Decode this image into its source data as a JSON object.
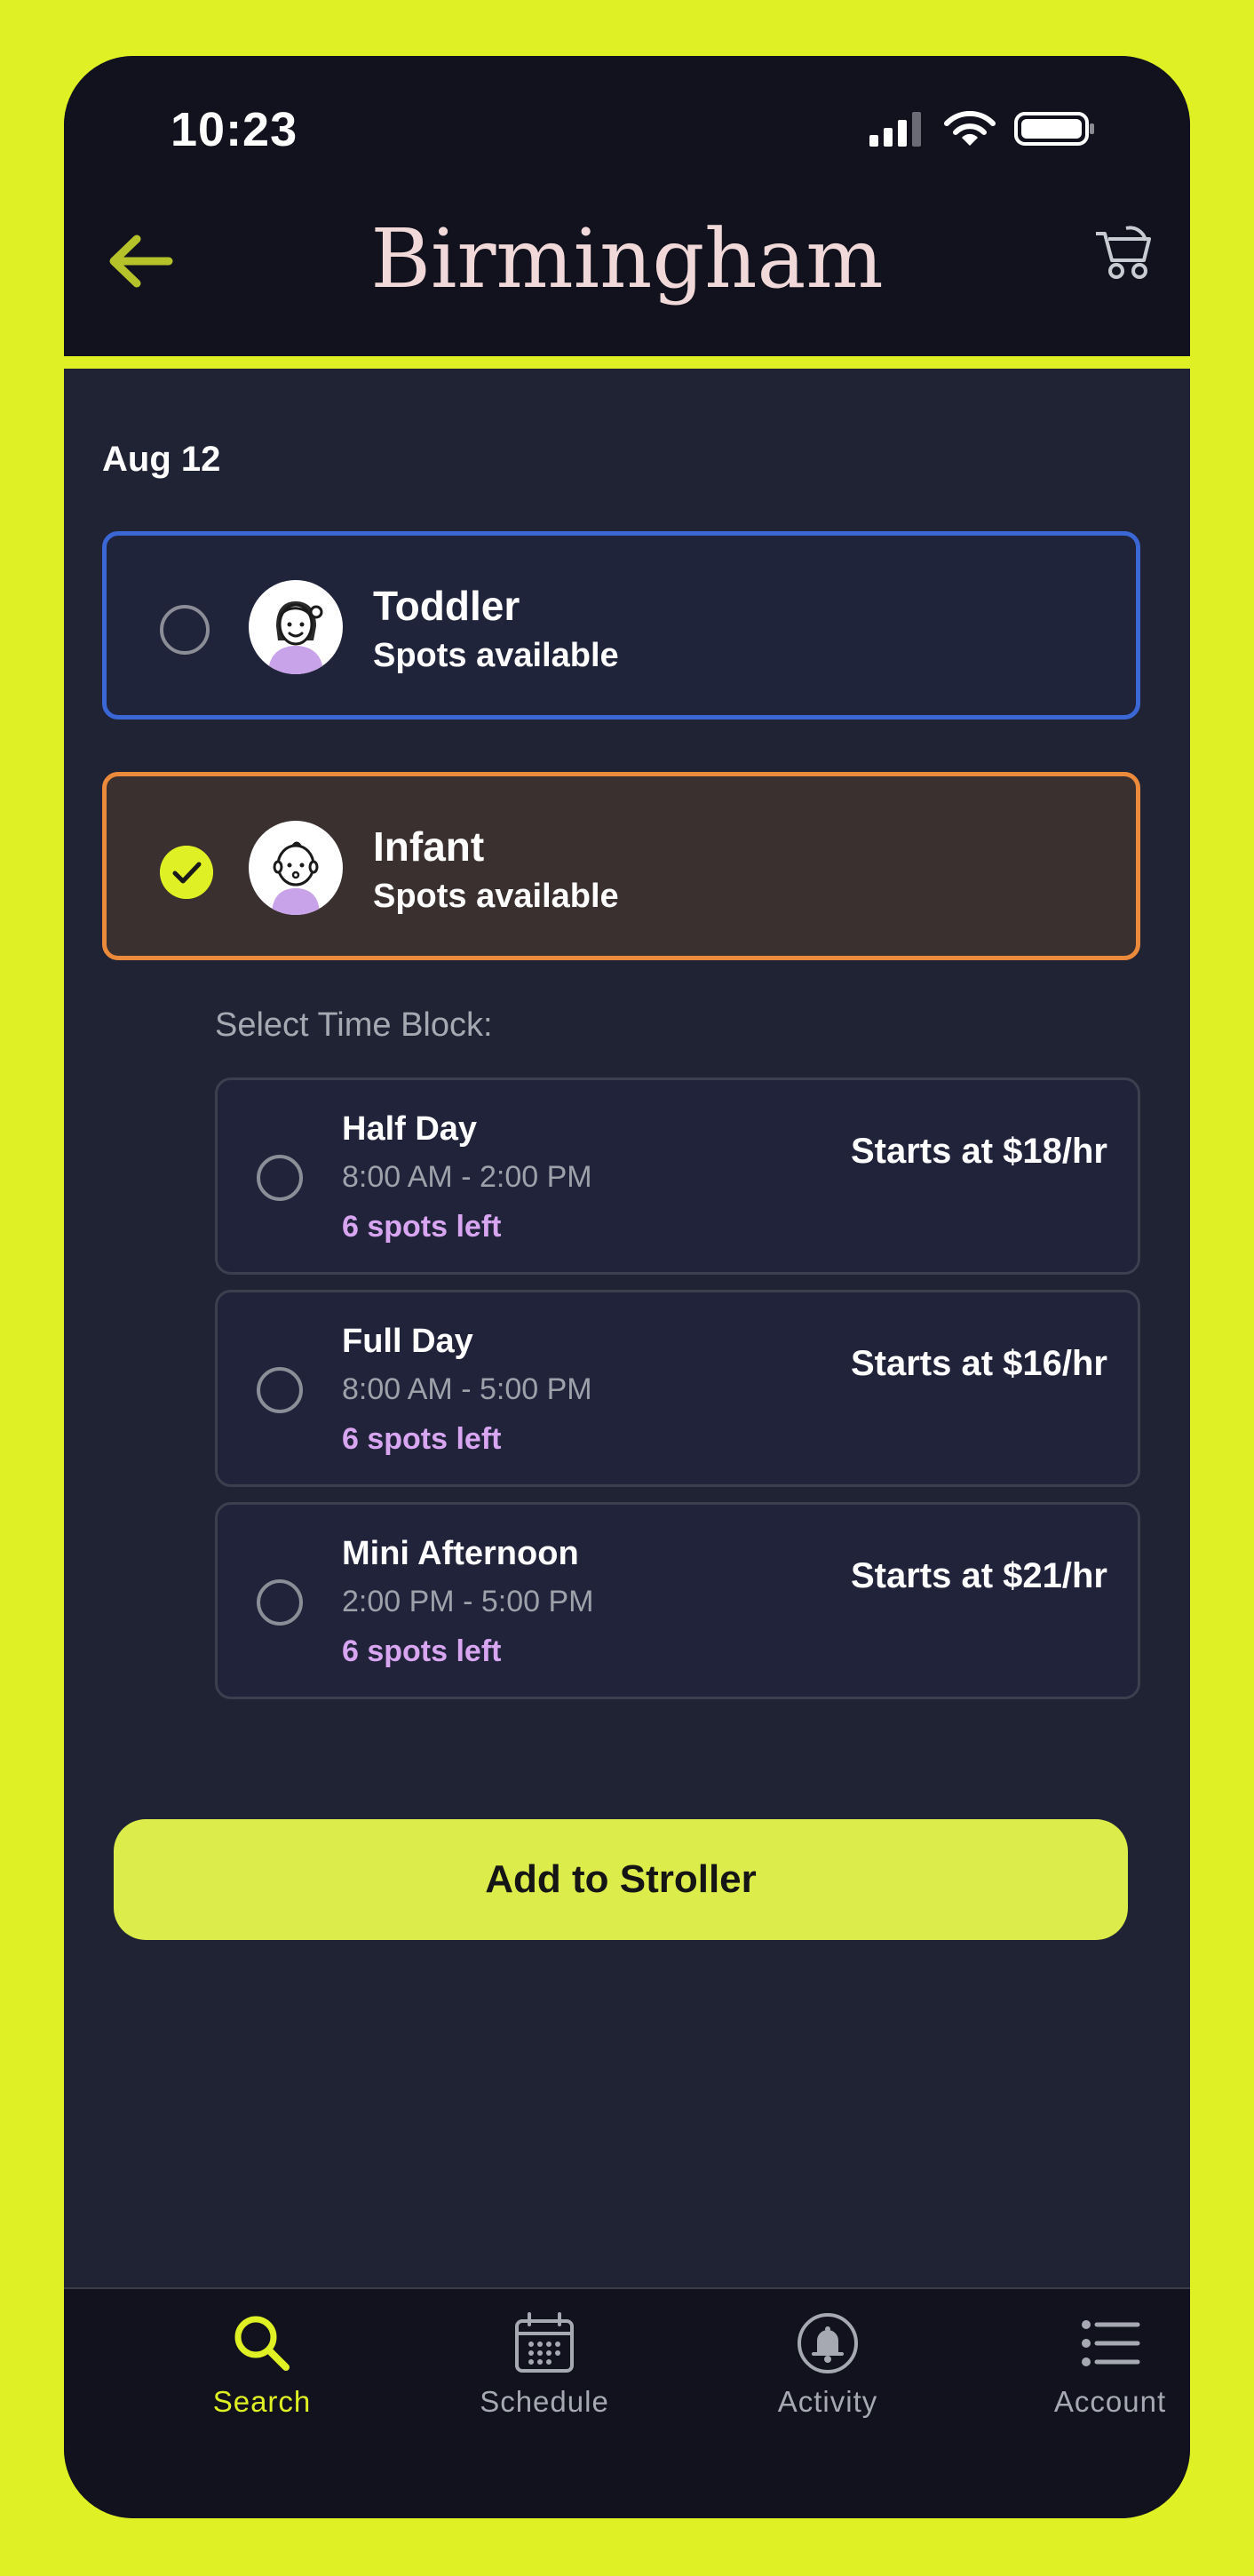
{
  "status_bar": {
    "time": "10:23"
  },
  "header": {
    "title": "Birmingham"
  },
  "date_label": "Aug 12",
  "options": [
    {
      "title": "Toddler",
      "subtitle": "Spots available",
      "selected": false
    },
    {
      "title": "Infant",
      "subtitle": "Spots available",
      "selected": true
    }
  ],
  "time_block": {
    "label": "Select Time Block:",
    "blocks": [
      {
        "name": "Half Day",
        "hours": "8:00 AM - 2:00 PM",
        "spots": "6 spots left",
        "price": "Starts at $18/hr"
      },
      {
        "name": "Full Day",
        "hours": "8:00 AM - 5:00 PM",
        "spots": "6 spots left",
        "price": "Starts at $16/hr"
      },
      {
        "name": "Mini Afternoon",
        "hours": "2:00 PM - 5:00 PM",
        "spots": "6 spots left",
        "price": "Starts at  $21/hr"
      }
    ]
  },
  "cta": {
    "label": "Add to Stroller"
  },
  "tabs": [
    {
      "label": "Search",
      "icon": "search-icon",
      "active": true
    },
    {
      "label": "Schedule",
      "icon": "calendar-icon",
      "active": false
    },
    {
      "label": "Activity",
      "icon": "bell-icon",
      "active": false
    },
    {
      "label": "Account",
      "icon": "list-icon",
      "active": false
    }
  ],
  "colors": {
    "accent": "#dff024",
    "background": "#202334",
    "header": "#11121d",
    "toddler_border": "#3b67d6",
    "infant_border": "#ec8a3c",
    "spots_text": "#d8a5f0",
    "title_text": "#f1d9da",
    "inactive_tab": "#a6a8b2"
  }
}
